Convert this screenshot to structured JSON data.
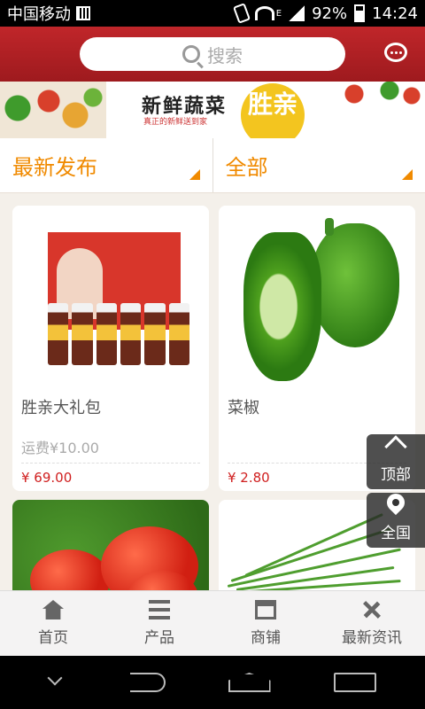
{
  "status_bar": {
    "carrier": "中国移动",
    "network": "E",
    "battery": "92%",
    "time": "14:24"
  },
  "header": {
    "search_placeholder": "搜索",
    "message_icon": "chat-icon"
  },
  "banner": {
    "title": "新鲜蔬菜",
    "subtitle": "真正的新鲜送到家",
    "logo_text": "胜亲"
  },
  "filters": [
    {
      "label": "最新发布"
    },
    {
      "label": "全部"
    }
  ],
  "products": [
    {
      "name": "胜亲大礼包",
      "shipping": "运费¥10.00",
      "price": "¥ 69.00"
    },
    {
      "name": "菜椒",
      "shipping": "",
      "price": "¥ 2.80"
    },
    {
      "name": "",
      "shipping": "",
      "price": ""
    },
    {
      "name": "",
      "shipping": "",
      "price": ""
    }
  ],
  "side_buttons": {
    "top": "顶部",
    "region": "全国"
  },
  "bottom_nav": [
    {
      "label": "首页",
      "icon": "home-icon"
    },
    {
      "label": "产品",
      "icon": "list-icon"
    },
    {
      "label": "商铺",
      "icon": "shop-icon"
    },
    {
      "label": "最新资讯",
      "icon": "news-icon"
    }
  ],
  "colors": {
    "header": "#b2222a",
    "accent": "#f08a00",
    "price": "#d02020"
  }
}
